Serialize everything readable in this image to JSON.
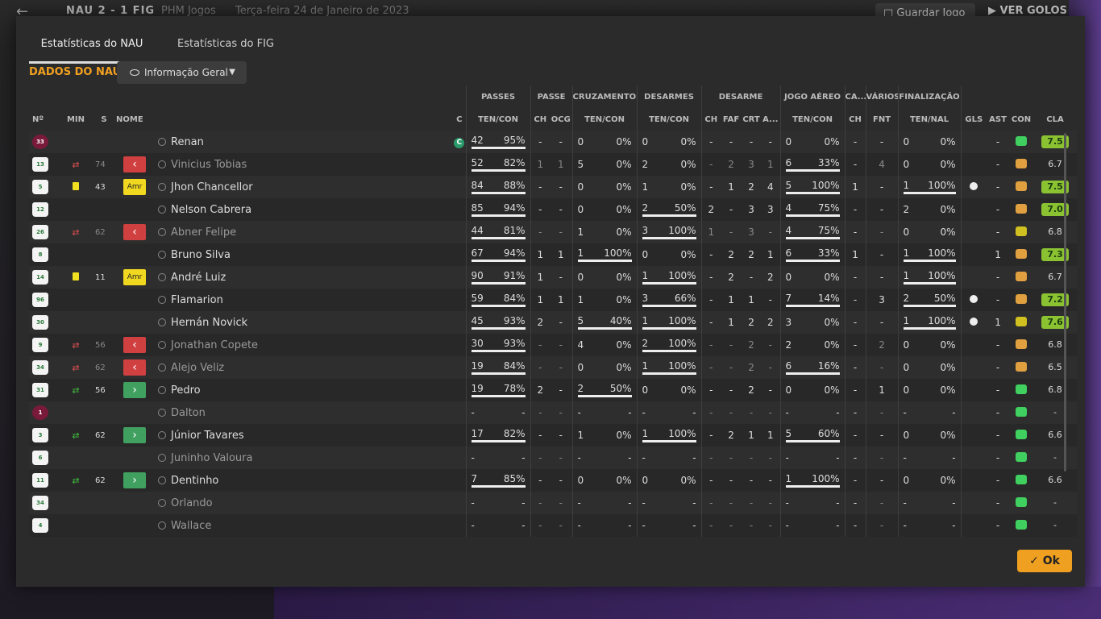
{
  "topbar": {
    "score": "NAU 2 - 1 FIG",
    "competition": "PHM Jogos",
    "date": "Terça-feira 24 de Janeiro de 2023",
    "save_label": "Guardar Jogo",
    "goals_label": "VER GOLOS"
  },
  "tabs": [
    {
      "label": "Estatísticas do NAU",
      "active": true
    },
    {
      "label": "Estatísticas do FIG",
      "active": false
    }
  ],
  "section_title": "DADOS DO NAU",
  "view_select": {
    "value": "Informação Geral"
  },
  "groups": [
    "PASSES",
    "PASSE",
    "CRUZAMENTOS",
    "DESARMES",
    "DESARME",
    "JOGO AÉREO",
    "CA...",
    "VÁRIOS",
    "FINALIZAÇÃO"
  ],
  "headers": {
    "num": "Nº",
    "min": "MIN",
    "s": "S",
    "name": "NOME",
    "c": "C",
    "pass": "TEN/CON",
    "ch": "CH",
    "ocg": "OCG",
    "cross": "TEN/CON",
    "tackles": "TEN/CON",
    "d_ch": "CH",
    "faf": "FAF",
    "crt": "CRT",
    "a": "A...",
    "aerial": "TEN/CON",
    "ca_ch": "CH",
    "fnt": "FNT",
    "fin": "TEN/NAL",
    "gls": "GLS",
    "ast": "AST",
    "con": "CON",
    "cla": "CLA"
  },
  "colors": {
    "accent": "#f0a020",
    "rating_high": "#8ac232",
    "sub_out": "#d04040",
    "sub_in": "#40a060",
    "condition_full": "#40d060",
    "condition_mid": "#e0a040",
    "condition_low": "#d0c020"
  },
  "players": [
    {
      "num": "33",
      "gk": true,
      "ev": "",
      "min": "",
      "s": "",
      "name": "Renan",
      "c": "C",
      "pt": "42",
      "pp": "95%",
      "ch": "-",
      "ocg": "-",
      "crt": "0",
      "crp": "0%",
      "dt": "0",
      "dp": "0%",
      "dch": "-",
      "faf": "-",
      "crt2": "-",
      "a": "-",
      "at": "0",
      "ap": "0%",
      "cach": "-",
      "fnt": "-",
      "ft": "0",
      "fp": "0%",
      "gls": "",
      "ast": "-",
      "con": "condition_full",
      "cla": "7.5",
      "hi": true,
      "sub": false,
      "pb": 1,
      "cb": 0,
      "db": 0,
      "ab": 0,
      "fb": 0
    },
    {
      "num": "13",
      "ev": "out",
      "min": "74",
      "s": "red",
      "name": "Vinicius Tobias",
      "c": "",
      "pt": "52",
      "pp": "82%",
      "ch": "1",
      "ocg": "1",
      "crt": "5",
      "crp": "0%",
      "dt": "2",
      "dp": "0%",
      "dch": "-",
      "faf": "2",
      "crt2": "3",
      "a": "1",
      "at": "6",
      "ap": "33%",
      "cach": "-",
      "fnt": "4",
      "ft": "0",
      "fp": "0%",
      "gls": "",
      "ast": "-",
      "con": "condition_mid",
      "cla": "6.7",
      "hi": false,
      "sub": true,
      "pb": 1,
      "cb": 0,
      "db": 0,
      "ab": 1,
      "fb": 0
    },
    {
      "num": "5",
      "ev": "yellow",
      "min": "43",
      "s": "amr",
      "name": "Jhon Chancellor",
      "c": "",
      "pt": "84",
      "pp": "88%",
      "ch": "-",
      "ocg": "-",
      "crt": "0",
      "crp": "0%",
      "dt": "1",
      "dp": "0%",
      "dch": "-",
      "faf": "1",
      "crt2": "2",
      "a": "4",
      "at": "5",
      "ap": "100%",
      "cach": "1",
      "fnt": "-",
      "ft": "1",
      "fp": "100%",
      "gls": "ball",
      "ast": "-",
      "con": "condition_mid",
      "cla": "7.5",
      "hi": true,
      "sub": false,
      "pb": 1,
      "cb": 0,
      "db": 0,
      "ab": 1,
      "fb": 1
    },
    {
      "num": "12",
      "ev": "",
      "min": "",
      "s": "",
      "name": "Nelson Cabrera",
      "c": "",
      "pt": "85",
      "pp": "94%",
      "ch": "-",
      "ocg": "-",
      "crt": "0",
      "crp": "0%",
      "dt": "2",
      "dp": "50%",
      "dch": "2",
      "faf": "-",
      "crt2": "3",
      "a": "3",
      "at": "4",
      "ap": "75%",
      "cach": "-",
      "fnt": "-",
      "ft": "2",
      "fp": "0%",
      "gls": "",
      "ast": "-",
      "con": "condition_mid",
      "cla": "7.0",
      "hi": true,
      "sub": false,
      "pb": 1,
      "cb": 0,
      "db": 1,
      "ab": 1,
      "fb": 0
    },
    {
      "num": "26",
      "ev": "out",
      "min": "62",
      "s": "red",
      "name": "Abner Felipe",
      "c": "",
      "pt": "44",
      "pp": "81%",
      "ch": "-",
      "ocg": "-",
      "crt": "1",
      "crp": "0%",
      "dt": "3",
      "dp": "100%",
      "dch": "1",
      "faf": "-",
      "crt2": "3",
      "a": "-",
      "at": "4",
      "ap": "75%",
      "cach": "-",
      "fnt": "-",
      "ft": "0",
      "fp": "0%",
      "gls": "",
      "ast": "-",
      "con": "condition_low",
      "cla": "6.8",
      "hi": false,
      "sub": true,
      "pb": 1,
      "cb": 0,
      "db": 1,
      "ab": 1,
      "fb": 0
    },
    {
      "num": "8",
      "ev": "",
      "min": "",
      "s": "",
      "name": "Bruno Silva",
      "c": "",
      "pt": "67",
      "pp": "94%",
      "ch": "1",
      "ocg": "1",
      "crt": "1",
      "crp": "100%",
      "dt": "0",
      "dp": "0%",
      "dch": "-",
      "faf": "2",
      "crt2": "2",
      "a": "1",
      "at": "6",
      "ap": "33%",
      "cach": "1",
      "fnt": "-",
      "ft": "1",
      "fp": "100%",
      "gls": "",
      "ast": "1",
      "con": "condition_mid",
      "cla": "7.3",
      "hi": true,
      "sub": false,
      "pb": 1,
      "cb": 1,
      "db": 0,
      "ab": 1,
      "fb": 1
    },
    {
      "num": "14",
      "ev": "yellow",
      "min": "11",
      "s": "amr",
      "name": "André Luiz",
      "c": "",
      "pt": "90",
      "pp": "91%",
      "ch": "1",
      "ocg": "-",
      "crt": "0",
      "crp": "0%",
      "dt": "1",
      "dp": "100%",
      "dch": "-",
      "faf": "2",
      "crt2": "-",
      "a": "2",
      "at": "0",
      "ap": "0%",
      "cach": "-",
      "fnt": "-",
      "ft": "1",
      "fp": "100%",
      "gls": "",
      "ast": "-",
      "con": "condition_mid",
      "cla": "6.7",
      "hi": false,
      "sub": false,
      "pb": 1,
      "cb": 0,
      "db": 1,
      "ab": 0,
      "fb": 1
    },
    {
      "num": "96",
      "ev": "",
      "min": "",
      "s": "",
      "name": "Flamarion",
      "c": "",
      "pt": "59",
      "pp": "84%",
      "ch": "1",
      "ocg": "1",
      "crt": "1",
      "crp": "0%",
      "dt": "3",
      "dp": "66%",
      "dch": "-",
      "faf": "1",
      "crt2": "1",
      "a": "-",
      "at": "7",
      "ap": "14%",
      "cach": "-",
      "fnt": "3",
      "ft": "2",
      "fp": "50%",
      "gls": "ball",
      "ast": "-",
      "con": "condition_mid",
      "cla": "7.2",
      "hi": true,
      "sub": false,
      "pb": 1,
      "cb": 0,
      "db": 1,
      "ab": 1,
      "fb": 1
    },
    {
      "num": "30",
      "ev": "",
      "min": "",
      "s": "",
      "name": "Hernán Novick",
      "c": "",
      "pt": "45",
      "pp": "93%",
      "ch": "2",
      "ocg": "-",
      "crt": "5",
      "crp": "40%",
      "dt": "1",
      "dp": "100%",
      "dch": "-",
      "faf": "1",
      "crt2": "2",
      "a": "2",
      "at": "3",
      "ap": "0%",
      "cach": "-",
      "fnt": "-",
      "ft": "1",
      "fp": "100%",
      "gls": "ball",
      "ast": "1",
      "con": "condition_low",
      "cla": "7.6",
      "hi": true,
      "sub": false,
      "pb": 1,
      "cb": 1,
      "db": 1,
      "ab": 0,
      "fb": 1
    },
    {
      "num": "9",
      "ev": "out",
      "min": "56",
      "s": "red",
      "name": "Jonathan Copete",
      "c": "",
      "pt": "30",
      "pp": "93%",
      "ch": "-",
      "ocg": "-",
      "crt": "4",
      "crp": "0%",
      "dt": "2",
      "dp": "100%",
      "dch": "-",
      "faf": "-",
      "crt2": "2",
      "a": "-",
      "at": "2",
      "ap": "0%",
      "cach": "-",
      "fnt": "2",
      "ft": "0",
      "fp": "0%",
      "gls": "",
      "ast": "-",
      "con": "condition_mid",
      "cla": "6.8",
      "hi": false,
      "sub": true,
      "pb": 1,
      "cb": 0,
      "db": 1,
      "ab": 0,
      "fb": 0
    },
    {
      "num": "34",
      "ev": "out",
      "min": "62",
      "s": "red",
      "name": "Alejo Veliz",
      "c": "",
      "pt": "19",
      "pp": "84%",
      "ch": "-",
      "ocg": "-",
      "crt": "0",
      "crp": "0%",
      "dt": "1",
      "dp": "100%",
      "dch": "-",
      "faf": "-",
      "crt2": "2",
      "a": "-",
      "at": "6",
      "ap": "16%",
      "cach": "-",
      "fnt": "-",
      "ft": "0",
      "fp": "0%",
      "gls": "",
      "ast": "-",
      "con": "condition_mid",
      "cla": "6.5",
      "hi": false,
      "sub": true,
      "pb": 1,
      "cb": 0,
      "db": 1,
      "ab": 1,
      "fb": 0
    },
    {
      "num": "31",
      "ev": "in",
      "min": "56",
      "s": "green",
      "name": "Pedro",
      "c": "",
      "pt": "19",
      "pp": "78%",
      "ch": "2",
      "ocg": "-",
      "crt": "2",
      "crp": "50%",
      "dt": "0",
      "dp": "0%",
      "dch": "-",
      "faf": "-",
      "crt2": "2",
      "a": "-",
      "at": "0",
      "ap": "0%",
      "cach": "-",
      "fnt": "1",
      "ft": "0",
      "fp": "0%",
      "gls": "",
      "ast": "-",
      "con": "condition_full",
      "cla": "6.8",
      "hi": false,
      "sub": false,
      "pb": 1,
      "cb": 1,
      "db": 0,
      "ab": 0,
      "fb": 0
    },
    {
      "num": "1",
      "gk": true,
      "ev": "",
      "min": "",
      "s": "",
      "name": "Dalton",
      "c": "",
      "pt": "-",
      "pp": "-",
      "ch": "-",
      "ocg": "-",
      "crt": "-",
      "crp": "-",
      "dt": "-",
      "dp": "-",
      "dch": "-",
      "faf": "-",
      "crt2": "-",
      "a": "-",
      "at": "-",
      "ap": "-",
      "cach": "-",
      "fnt": "-",
      "ft": "-",
      "fp": "-",
      "gls": "",
      "ast": "-",
      "con": "condition_full",
      "cla": "-",
      "hi": false,
      "sub": true,
      "pb": 0,
      "cb": 0,
      "db": 0,
      "ab": 0,
      "fb": 0
    },
    {
      "num": "3",
      "ev": "in",
      "min": "62",
      "s": "green",
      "name": "Júnior Tavares",
      "c": "",
      "pt": "17",
      "pp": "82%",
      "ch": "-",
      "ocg": "-",
      "crt": "1",
      "crp": "0%",
      "dt": "1",
      "dp": "100%",
      "dch": "-",
      "faf": "2",
      "crt2": "1",
      "a": "1",
      "at": "5",
      "ap": "60%",
      "cach": "-",
      "fnt": "-",
      "ft": "0",
      "fp": "0%",
      "gls": "",
      "ast": "-",
      "con": "condition_full",
      "cla": "6.6",
      "hi": false,
      "sub": false,
      "pb": 1,
      "cb": 0,
      "db": 1,
      "ab": 1,
      "fb": 0
    },
    {
      "num": "6",
      "ev": "",
      "min": "",
      "s": "",
      "name": "Juninho Valoura",
      "c": "",
      "pt": "-",
      "pp": "-",
      "ch": "-",
      "ocg": "-",
      "crt": "-",
      "crp": "-",
      "dt": "-",
      "dp": "-",
      "dch": "-",
      "faf": "-",
      "crt2": "-",
      "a": "-",
      "at": "-",
      "ap": "-",
      "cach": "-",
      "fnt": "-",
      "ft": "-",
      "fp": "-",
      "gls": "",
      "ast": "-",
      "con": "condition_full",
      "cla": "-",
      "hi": false,
      "sub": true,
      "pb": 0,
      "cb": 0,
      "db": 0,
      "ab": 0,
      "fb": 0
    },
    {
      "num": "11",
      "ev": "in",
      "min": "62",
      "s": "green",
      "name": "Dentinho",
      "c": "",
      "pt": "7",
      "pp": "85%",
      "ch": "-",
      "ocg": "-",
      "crt": "0",
      "crp": "0%",
      "dt": "0",
      "dp": "0%",
      "dch": "-",
      "faf": "-",
      "crt2": "-",
      "a": "-",
      "at": "1",
      "ap": "100%",
      "cach": "-",
      "fnt": "-",
      "ft": "0",
      "fp": "0%",
      "gls": "",
      "ast": "-",
      "con": "condition_full",
      "cla": "6.6",
      "hi": false,
      "sub": false,
      "pb": 1,
      "cb": 0,
      "db": 0,
      "ab": 1,
      "fb": 0
    },
    {
      "num": "34",
      "ev": "",
      "min": "",
      "s": "",
      "name": "Orlando",
      "c": "",
      "pt": "-",
      "pp": "-",
      "ch": "-",
      "ocg": "-",
      "crt": "-",
      "crp": "-",
      "dt": "-",
      "dp": "-",
      "dch": "-",
      "faf": "-",
      "crt2": "-",
      "a": "-",
      "at": "-",
      "ap": "-",
      "cach": "-",
      "fnt": "-",
      "ft": "-",
      "fp": "-",
      "gls": "",
      "ast": "-",
      "con": "condition_full",
      "cla": "-",
      "hi": false,
      "sub": true,
      "pb": 0,
      "cb": 0,
      "db": 0,
      "ab": 0,
      "fb": 0
    },
    {
      "num": "4",
      "ev": "",
      "min": "",
      "s": "",
      "name": "Wallace",
      "c": "",
      "pt": "-",
      "pp": "-",
      "ch": "-",
      "ocg": "-",
      "crt": "-",
      "crp": "-",
      "dt": "-",
      "dp": "-",
      "dch": "-",
      "faf": "-",
      "crt2": "-",
      "a": "-",
      "at": "-",
      "ap": "-",
      "cach": "-",
      "fnt": "-",
      "ft": "-",
      "fp": "-",
      "gls": "",
      "ast": "-",
      "con": "condition_full",
      "cla": "-",
      "hi": false,
      "sub": true,
      "pb": 0,
      "cb": 0,
      "db": 0,
      "ab": 0,
      "fb": 0
    }
  ],
  "ok_label": "Ok"
}
